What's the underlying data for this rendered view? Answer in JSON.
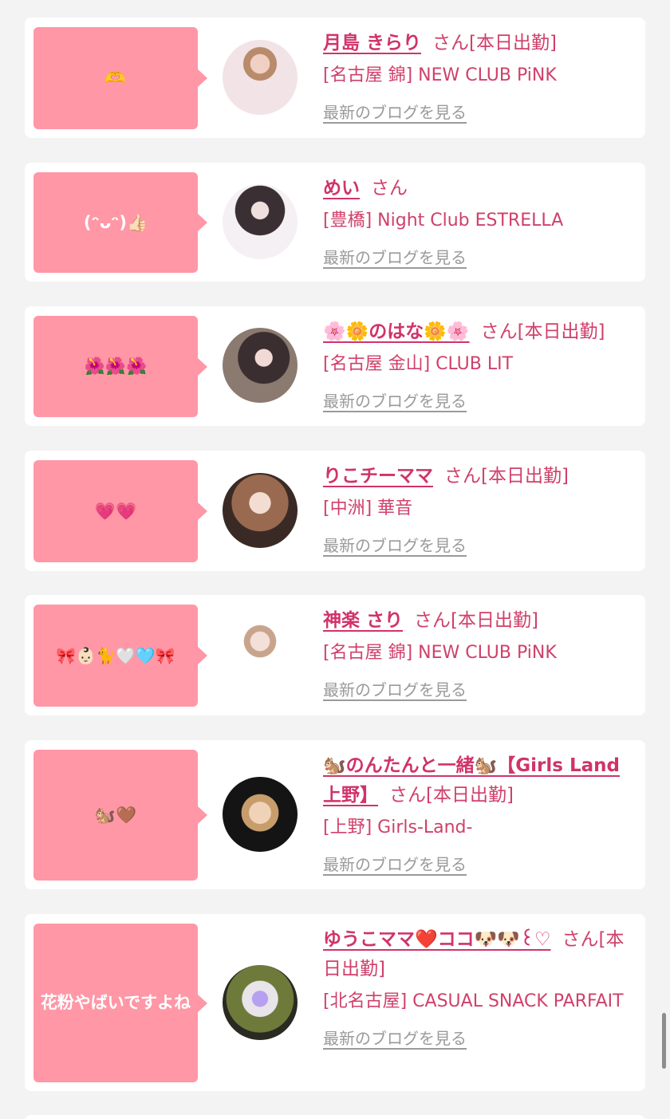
{
  "list": [
    {
      "message": "🫶",
      "name": "月島 きらり",
      "san": "さん",
      "status": "[本日出勤]",
      "shop": "[名古屋 錦] NEW CLUB PiNK",
      "blog_link": "最新のブログを見る",
      "avatar_style": "light-bg-portrait"
    },
    {
      "message": "(ᵔᴗᵔ)👍🏻",
      "name": "めい",
      "san": "さん",
      "status": "",
      "shop": "[豊橋] Night Club ESTRELLA",
      "blog_link": "最新のブログを見る",
      "avatar_style": "light-bg-portrait"
    },
    {
      "message": "🌺🌺🌺",
      "name": "🌸🌼のはな🌼🌸",
      "san": "さん",
      "status": "[本日出勤]",
      "shop": "[名古屋 金山] CLUB LIT",
      "blog_link": "最新のブログを見る",
      "avatar_style": "dark-portrait"
    },
    {
      "message": "💗💗",
      "name": "りこチーママ",
      "san": "さん",
      "status": "[本日出勤]",
      "shop": "[中洲] 華音",
      "blog_link": "最新のブログを見る",
      "avatar_style": "warm-portrait"
    },
    {
      "message": "🎀👶🏻🐈🤍🩵🎀",
      "name": "神楽 さり",
      "san": "さん",
      "status": "[本日出勤]",
      "shop": "[名古屋 錦] NEW CLUB PiNK",
      "blog_link": "最新のブログを見る",
      "avatar_style": "light-bg-portrait"
    },
    {
      "message": "🐿️🤎",
      "name": "🐿️のんたんと一緒🐿️【Girls Land上野】",
      "san": "さん",
      "status": "[本日出勤]",
      "shop": "[上野] Girls-Land-",
      "blog_link": "最新のブログを見る",
      "avatar_style": "dark-portrait"
    },
    {
      "message": "花粉やばいですよね",
      "name": "ゆうこママ❤️ココ🐶🐶꒰♡",
      "san": "さん",
      "status": "[本日出勤]",
      "shop": "[北名古屋] CASUAL SNACK PARFAIT",
      "blog_link": "最新のブログを見る",
      "avatar_style": "flowers-portrait"
    }
  ],
  "colors": {
    "accent_pink": "#d0336a",
    "bubble_pink": "#ff97a6",
    "link_gray": "#9a9a9a",
    "background": "#f3f3f3"
  }
}
